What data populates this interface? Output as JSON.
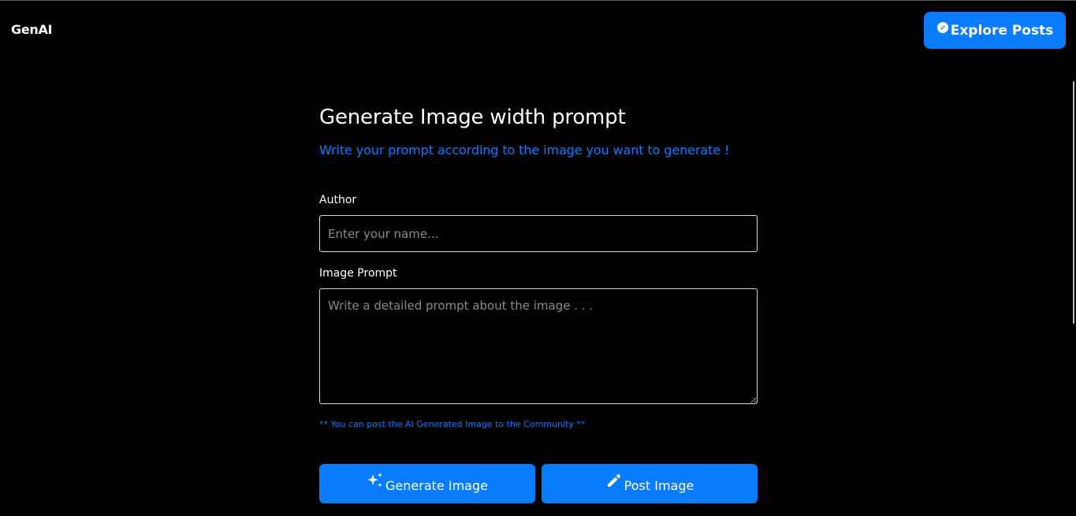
{
  "navbar": {
    "brand": "GenAI",
    "explore_button": {
      "label": "Explore Posts",
      "icon": "compass-icon"
    }
  },
  "form": {
    "title": "Generate Image width prompt",
    "subtitle": "Write your prompt according to the image you want to generate !",
    "author": {
      "label": "Author",
      "placeholder": "Enter your name...",
      "value": ""
    },
    "prompt": {
      "label": "Image Prompt",
      "placeholder": "Write a detailed prompt about the image . . .",
      "value": ""
    },
    "note": "** You can post the AI Generated Image to the Community **",
    "generate_button": {
      "label": "Generate Image",
      "icon": "sparkles-icon"
    },
    "post_button": {
      "label": "Post Image",
      "icon": "pencil-icon"
    }
  },
  "colors": {
    "background": "#000000",
    "accent": "#0a7cff",
    "text": "#ffffff",
    "placeholder": "#8a8a8a",
    "input_border": "#d9d9d9"
  }
}
